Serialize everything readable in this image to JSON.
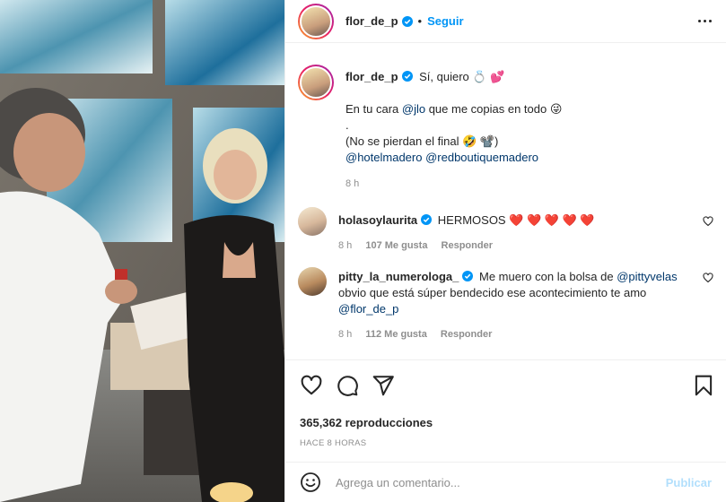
{
  "post": {
    "author": "flor_de_p",
    "follow_label": "Seguir"
  },
  "caption": {
    "author": "flor_de_p",
    "line1": "Sí, quiero 💍 💕",
    "line2_prefix": "En tu cara ",
    "line2_mention": "@jlo",
    "line2_suffix": " que me copias en todo 😜",
    "line3": ".",
    "line4": "(No se pierdan el final 🤣 📽️)",
    "tag1": "@hotelmadero",
    "tag2": "@redboutiquemadero",
    "time": "8 h"
  },
  "comments": [
    {
      "user": "holasoylaurita",
      "text": "HERMOSOS ❤️ ❤️ ❤️ ❤️ ❤️",
      "time": "8 h",
      "likes": "107 Me gusta",
      "reply": "Responder"
    },
    {
      "user": "pitty_la_numerologa_",
      "text_prefix": "Me muero con la bolsa de ",
      "mention1": "@pittyvelas",
      "text_mid": " obvio que está súper bendecido ese acontecimiento te amo ",
      "mention2": "@flor_de_p",
      "time": "8 h",
      "likes": "112 Me gusta",
      "reply": "Responder"
    }
  ],
  "stats": {
    "views": "365,362 reproducciones",
    "ago": "HACE 8 HORAS"
  },
  "composer": {
    "placeholder": "Agrega un comentario...",
    "publish_label": "Publicar"
  },
  "colors": {
    "accent": "#0095f6",
    "mention": "#00376b",
    "muted": "#8e8e8e",
    "verified": "#0095f6"
  },
  "icons": [
    "verified-icon",
    "more-options-icon",
    "heart-icon",
    "comment-icon",
    "share-icon",
    "save-icon",
    "emoji-icon"
  ]
}
